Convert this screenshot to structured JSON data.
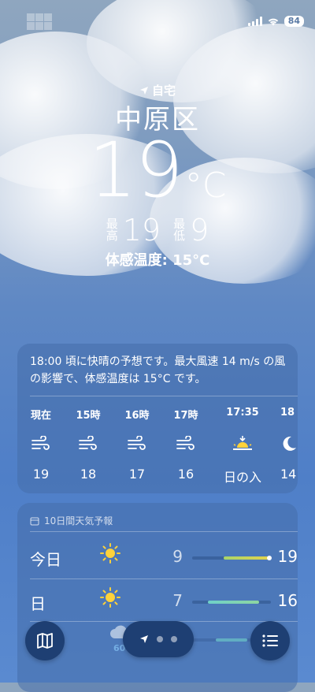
{
  "status": {
    "battery": "84"
  },
  "location": {
    "label": "自宅",
    "city": "中原区"
  },
  "current": {
    "temp": "19",
    "unit": "°C",
    "high_label": "最\n高",
    "high": "19",
    "low_label": "最\n低",
    "low": "9",
    "feels_like": "体感温度: 15°C"
  },
  "hourly": {
    "summary": "18:00 頃に快晴の予想です。最大風速 14 m/s の風の影響で、体感温度は 15°C です。",
    "items": [
      {
        "time": "現在",
        "icon": "wind-icon",
        "temp": "19"
      },
      {
        "time": "15時",
        "icon": "wind-icon",
        "temp": "18"
      },
      {
        "time": "16時",
        "icon": "wind-icon",
        "temp": "17"
      },
      {
        "time": "17時",
        "icon": "wind-icon",
        "temp": "16"
      },
      {
        "time": "17:35",
        "icon": "sunset-icon",
        "temp": "日の入"
      },
      {
        "time": "18",
        "icon": "moon-icon",
        "temp": "14"
      }
    ]
  },
  "daily": {
    "title": "10日間天気予報",
    "rows": [
      {
        "day": "今日",
        "icon": "sun-icon",
        "low": "9",
        "high": "19",
        "range": [
          0.4,
          1.0
        ],
        "color": "#c6d86a",
        "current_marker": true
      },
      {
        "day": "日",
        "icon": "sun-icon",
        "low": "7",
        "high": "16",
        "range": [
          0.2,
          0.85
        ],
        "color": "#6fd0c9",
        "current_marker": false
      },
      {
        "day": "",
        "icon": "cloud-icon",
        "low": "",
        "high": "",
        "precip": "60%",
        "range": [
          0.3,
          0.7
        ],
        "color": "#6fd0c9",
        "current_marker": false
      }
    ]
  },
  "controls": {
    "map": "map-icon",
    "list": "list-icon"
  }
}
